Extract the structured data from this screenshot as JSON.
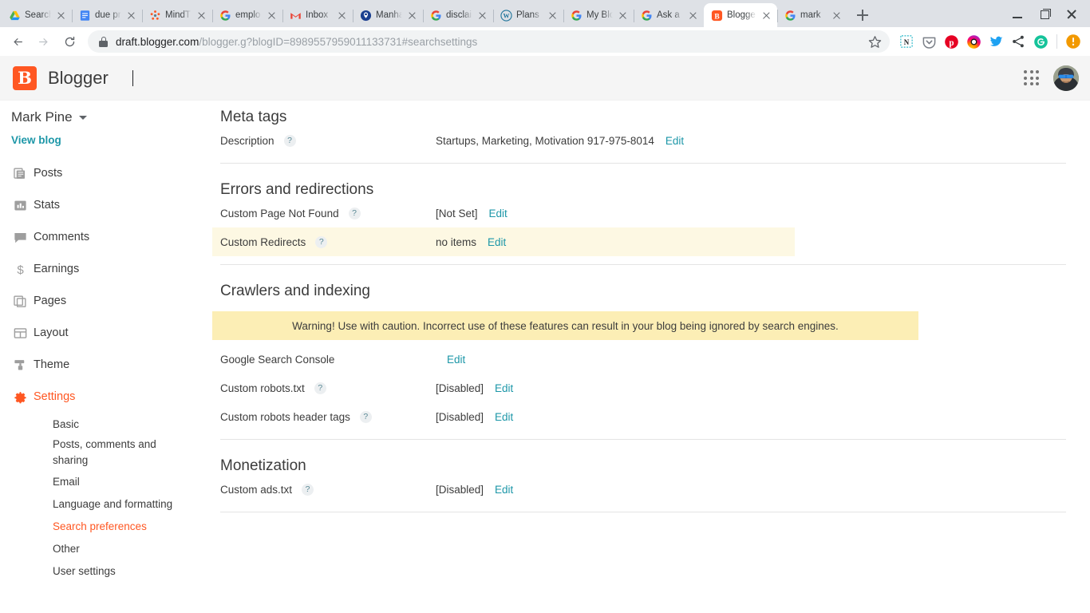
{
  "browser": {
    "tabs": [
      {
        "title": "Search",
        "favicon": "gdrive-icon",
        "active": false
      },
      {
        "title": "due pr",
        "favicon": "gdocs-icon",
        "active": false
      },
      {
        "title": "MindT",
        "favicon": "mindtools-icon",
        "active": false
      },
      {
        "title": "emplo",
        "favicon": "google-icon",
        "active": false
      },
      {
        "title": "Inbox",
        "favicon": "gmail-icon",
        "active": false
      },
      {
        "title": "Manha",
        "favicon": "mappin-icon",
        "active": false
      },
      {
        "title": "disclai",
        "favicon": "google-icon",
        "active": false
      },
      {
        "title": "Plans",
        "favicon": "wordpress-icon",
        "active": false
      },
      {
        "title": "My Blo",
        "favicon": "google-icon",
        "active": false
      },
      {
        "title": "Ask a",
        "favicon": "google-icon",
        "active": false
      },
      {
        "title": "Blogge",
        "favicon": "blogger-icon",
        "active": true
      },
      {
        "title": "mark",
        "favicon": "google-icon",
        "active": false
      }
    ],
    "new_tab_label": "+",
    "window_controls": [
      "minimize",
      "maximize",
      "close"
    ],
    "address": {
      "secure_host": "draft.blogger.com",
      "path": "/blogger.g?blogID=8989557959011133731#searchsettings",
      "lock_icon": "lock-icon"
    },
    "extensions": [
      "notion-icon",
      "pocket-icon",
      "pinterest-icon",
      "instagram-icon",
      "twitter-icon",
      "share-icon",
      "grammarly-icon",
      "profile-alert-icon"
    ]
  },
  "header": {
    "logo_letter": "B",
    "brand": "Blogger",
    "apps_grid_icon": "apps-grid-icon",
    "avatar_icon": "user-avatar"
  },
  "sidebar": {
    "blog_name": "Mark Pine",
    "view_blog": "View blog",
    "items": [
      {
        "label": "Posts",
        "icon": "posts-icon",
        "active": false
      },
      {
        "label": "Stats",
        "icon": "stats-icon",
        "active": false
      },
      {
        "label": "Comments",
        "icon": "comments-icon",
        "active": false
      },
      {
        "label": "Earnings",
        "icon": "earnings-icon",
        "active": false
      },
      {
        "label": "Pages",
        "icon": "pages-icon",
        "active": false
      },
      {
        "label": "Layout",
        "icon": "layout-icon",
        "active": false
      },
      {
        "label": "Theme",
        "icon": "theme-icon",
        "active": false
      },
      {
        "label": "Settings",
        "icon": "settings-gear-icon",
        "active": true
      }
    ],
    "settings_subitems": [
      {
        "label": "Basic",
        "active": false
      },
      {
        "label": "Posts, comments and sharing",
        "active": false
      },
      {
        "label": "Email",
        "active": false
      },
      {
        "label": "Language and formatting",
        "active": false
      },
      {
        "label": "Search preferences",
        "active": true
      },
      {
        "label": "Other",
        "active": false
      },
      {
        "label": "User settings",
        "active": false
      }
    ]
  },
  "main": {
    "sections": [
      {
        "title": "Meta tags",
        "rows": [
          {
            "label": "Description",
            "help": "?",
            "value": "Startups, Marketing, Motivation 917-975-8014",
            "edit": "Edit",
            "highlight": false
          }
        ]
      },
      {
        "title": "Errors and redirections",
        "rows": [
          {
            "label": "Custom Page Not Found",
            "help": "?",
            "value": "[Not Set]",
            "edit": "Edit",
            "highlight": false
          },
          {
            "label": "Custom Redirects",
            "help": "?",
            "value": "no items",
            "edit": "Edit",
            "highlight": true
          }
        ]
      },
      {
        "title": "Crawlers and indexing",
        "warning": "Warning! Use with caution. Incorrect use of these features can result in your blog being ignored by search engines.",
        "rows": [
          {
            "label": "Google Search Console",
            "help": "",
            "value": "",
            "edit": "Edit",
            "highlight": false
          },
          {
            "label": "Custom robots.txt",
            "help": "?",
            "value": "[Disabled]",
            "edit": "Edit",
            "highlight": false
          },
          {
            "label": "Custom robots header tags",
            "help": "?",
            "value": "[Disabled]",
            "edit": "Edit",
            "highlight": false
          }
        ]
      },
      {
        "title": "Monetization",
        "rows": [
          {
            "label": "Custom ads.txt",
            "help": "?",
            "value": "[Disabled]",
            "edit": "Edit",
            "highlight": false
          }
        ]
      }
    ]
  },
  "colors": {
    "accent_orange": "#ff5722",
    "link_teal": "#1d97a8",
    "warning_bg": "#fceeb5",
    "row_highlight": "#fdf8e3"
  }
}
